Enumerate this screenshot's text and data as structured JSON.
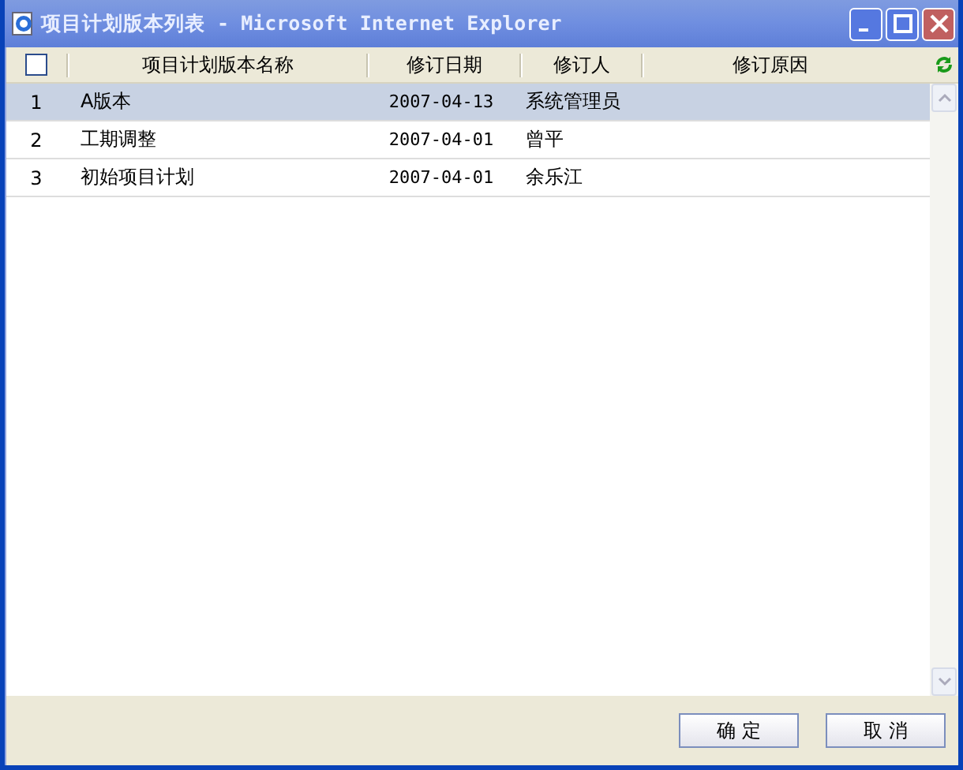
{
  "window": {
    "title": "项目计划版本列表 - Microsoft Internet Explorer"
  },
  "table": {
    "select_all": {
      "checked": false
    },
    "columns": [
      "项目计划版本名称",
      "修订日期",
      "修订人",
      "修订原因"
    ],
    "rows": [
      {
        "index": "1",
        "name": "A版本",
        "date": "2007-04-13",
        "reviser": "系统管理员",
        "reason": "",
        "selected": true
      },
      {
        "index": "2",
        "name": "工期调整",
        "date": "2007-04-01",
        "reviser": "曾平",
        "reason": "",
        "selected": false
      },
      {
        "index": "3",
        "name": "初始项目计划",
        "date": "2007-04-01",
        "reviser": "余乐江",
        "reason": "",
        "selected": false
      }
    ]
  },
  "buttons": [
    "确 定",
    "取 消"
  ]
}
